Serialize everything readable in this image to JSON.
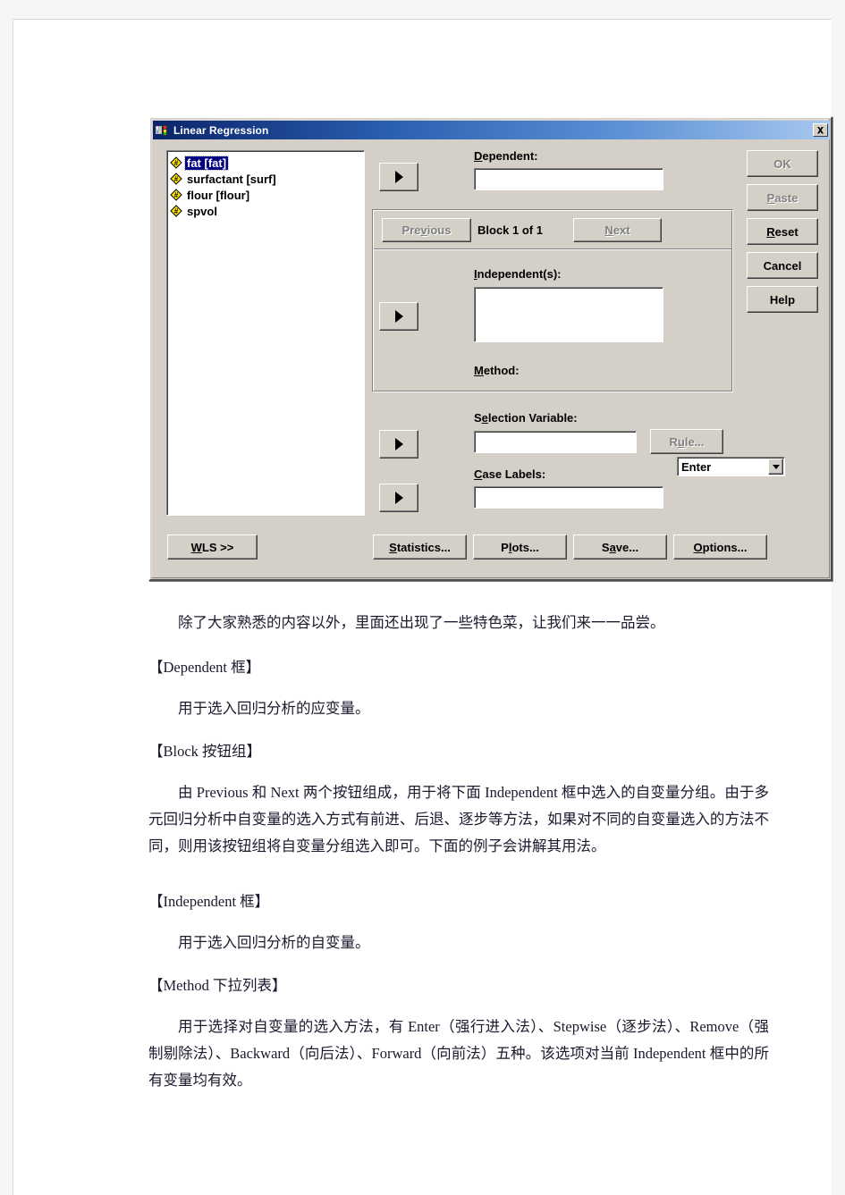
{
  "dialog": {
    "title": "Linear Regression",
    "app_icon": "spss-icon",
    "close_label": "✕",
    "variables": [
      {
        "label": "fat [fat]",
        "selected": true
      },
      {
        "label": "surfactant [surf]",
        "selected": false
      },
      {
        "label": "flour [flour]",
        "selected": false
      },
      {
        "label": "spvol",
        "selected": false
      }
    ],
    "dependent": {
      "label_pre": "D",
      "label_post": "ependent:",
      "value": "",
      "move_button": "▶"
    },
    "block": {
      "previous_pre": "Pre",
      "previous_mid": "v",
      "previous_post": "ious",
      "status": "Block 1 of 1",
      "next_pre": "N",
      "next_post": "ext"
    },
    "independent": {
      "label_pre": "I",
      "label_post": "ndependent(s):",
      "value": "",
      "move_button": "▶"
    },
    "method": {
      "label_pre": "M",
      "label_post": "ethod:",
      "value": "Enter",
      "options": [
        "Enter",
        "Stepwise",
        "Remove",
        "Backward",
        "Forward"
      ]
    },
    "selection_variable": {
      "label_pre": "S",
      "label_mid": "e",
      "label_post": "lection Variable:",
      "value": "",
      "move_button": "▶",
      "rule_pre": "R",
      "rule_mid": "u",
      "rule_post": "le..."
    },
    "case_labels": {
      "label_pre": "C",
      "label_post": "ase Labels:",
      "value": "",
      "move_button": "▶"
    },
    "right_buttons": [
      {
        "name": "ok",
        "pre": "",
        "accel": "",
        "post": "OK",
        "disabled": true
      },
      {
        "name": "paste",
        "pre": "",
        "accel": "P",
        "post": "aste",
        "disabled": true
      },
      {
        "name": "reset",
        "pre": "",
        "accel": "R",
        "post": "eset",
        "disabled": false
      },
      {
        "name": "cancel",
        "pre": "",
        "accel": "",
        "post": "Cancel",
        "disabled": false
      },
      {
        "name": "help",
        "pre": "",
        "accel": "",
        "post": "Help",
        "disabled": false
      }
    ],
    "bottom_buttons": [
      {
        "name": "wls",
        "pre": "W",
        "accel": "",
        "post": "LS >>",
        "accel_first": true
      },
      {
        "name": "statistics",
        "pre": "",
        "accel": "S",
        "post": "tatistics..."
      },
      {
        "name": "plots",
        "pre": "P",
        "accel": "l",
        "post": "ots..."
      },
      {
        "name": "save",
        "pre": "S",
        "accel": "a",
        "post": "ve..."
      },
      {
        "name": "options",
        "pre": "",
        "accel": "O",
        "post": "ptions..."
      }
    ],
    "colors": {
      "face": "#d4d0c8",
      "title_start": "#0a246a",
      "title_end": "#a6c8ee",
      "selection": "#000080",
      "var_icon": "#ffe400"
    }
  },
  "body": {
    "intro": "除了大家熟悉的内容以外，里面还出现了一些特色菜，让我们来一一品尝。",
    "h_dependent": "【Dependent 框】",
    "p_dependent": "用于选入回归分析的应变量。",
    "h_block": "【Block 按钮组】",
    "p_block": "由 Previous 和 Next 两个按钮组成，用于将下面 Independent 框中选入的自变量分组。由于多元回归分析中自变量的选入方式有前进、后退、逐步等方法，如果对不同的自变量选入的方法不同，则用该按钮组将自变量分组选入即可。下面的例子会讲解其用法。",
    "h_independent": "【Independent 框】",
    "p_independent": "用于选入回归分析的自变量。",
    "h_method": "【Method 下拉列表】",
    "p_method": "用于选择对自变量的选入方法，有 Enter（强行进入法）、Stepwise（逐步法）、Remove（强制剔除法）、Backward（向后法）、Forward（向前法）五种。该选项对当前 Independent 框中的所有变量均有效。"
  }
}
